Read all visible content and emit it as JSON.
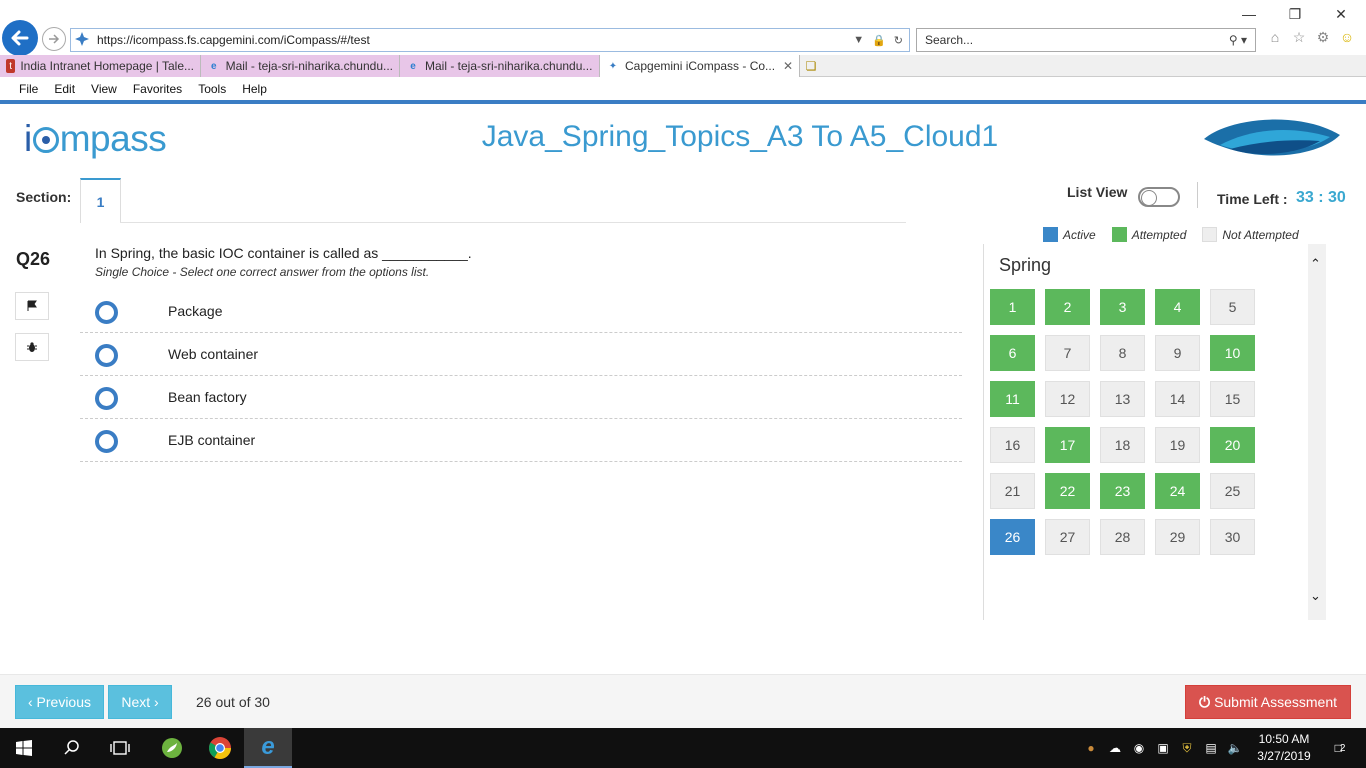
{
  "browser": {
    "url": "https://icompass.fs.capgemini.com/iCompass/#/test",
    "search_placeholder": "Search...",
    "tabs": [
      {
        "label": "India Intranet Homepage | Tale..."
      },
      {
        "label": "Mail - teja-sri-niharika.chundu..."
      },
      {
        "label": "Mail - teja-sri-niharika.chundu..."
      },
      {
        "label": "Capgemini iCompass - Co..."
      }
    ],
    "menu": [
      "File",
      "Edit",
      "View",
      "Favorites",
      "Tools",
      "Help"
    ]
  },
  "app": {
    "logo_i": "i",
    "logo_rest": "mpass",
    "test_title": "Java_Spring_Topics_A3 To A5_Cloud1"
  },
  "section": {
    "label": "Section:",
    "current": "1"
  },
  "header_controls": {
    "list_view_label": "List View",
    "time_left_label": "Time Left :",
    "time_left_value": "33 : 30"
  },
  "legend": [
    {
      "label": "Active",
      "color": "#3a87c8"
    },
    {
      "label": "Attempted",
      "color": "#5cb85c"
    },
    {
      "label": "Not Attempted",
      "color": "#eeeeee"
    }
  ],
  "question": {
    "number": "Q26",
    "text": "In Spring, the basic IOC container is called as ___________.",
    "hint": "Single Choice - Select one correct answer from the options list.",
    "options": [
      "Package",
      "Web container",
      "Bean factory",
      "EJB container"
    ]
  },
  "palette": {
    "title": "Spring",
    "questions": [
      {
        "n": "1",
        "status": "attempted"
      },
      {
        "n": "2",
        "status": "attempted"
      },
      {
        "n": "3",
        "status": "attempted"
      },
      {
        "n": "4",
        "status": "attempted"
      },
      {
        "n": "5",
        "status": "not"
      },
      {
        "n": "6",
        "status": "attempted"
      },
      {
        "n": "7",
        "status": "not"
      },
      {
        "n": "8",
        "status": "not"
      },
      {
        "n": "9",
        "status": "not"
      },
      {
        "n": "10",
        "status": "attempted"
      },
      {
        "n": "11",
        "status": "attempted"
      },
      {
        "n": "12",
        "status": "not"
      },
      {
        "n": "13",
        "status": "not"
      },
      {
        "n": "14",
        "status": "not"
      },
      {
        "n": "15",
        "status": "not"
      },
      {
        "n": "16",
        "status": "not"
      },
      {
        "n": "17",
        "status": "attempted"
      },
      {
        "n": "18",
        "status": "not"
      },
      {
        "n": "19",
        "status": "not"
      },
      {
        "n": "20",
        "status": "attempted"
      },
      {
        "n": "21",
        "status": "not"
      },
      {
        "n": "22",
        "status": "attempted"
      },
      {
        "n": "23",
        "status": "attempted"
      },
      {
        "n": "24",
        "status": "attempted"
      },
      {
        "n": "25",
        "status": "not"
      },
      {
        "n": "26",
        "status": "active"
      },
      {
        "n": "27",
        "status": "not"
      },
      {
        "n": "28",
        "status": "not"
      },
      {
        "n": "29",
        "status": "not"
      },
      {
        "n": "30",
        "status": "not"
      }
    ]
  },
  "footer": {
    "previous_label": "‹ Previous",
    "next_label": "Next ›",
    "progress": "26 out of 30",
    "submit_label": "Submit Assessment"
  },
  "taskbar": {
    "time": "10:50 AM",
    "date": "3/27/2019",
    "notifications": "2"
  }
}
